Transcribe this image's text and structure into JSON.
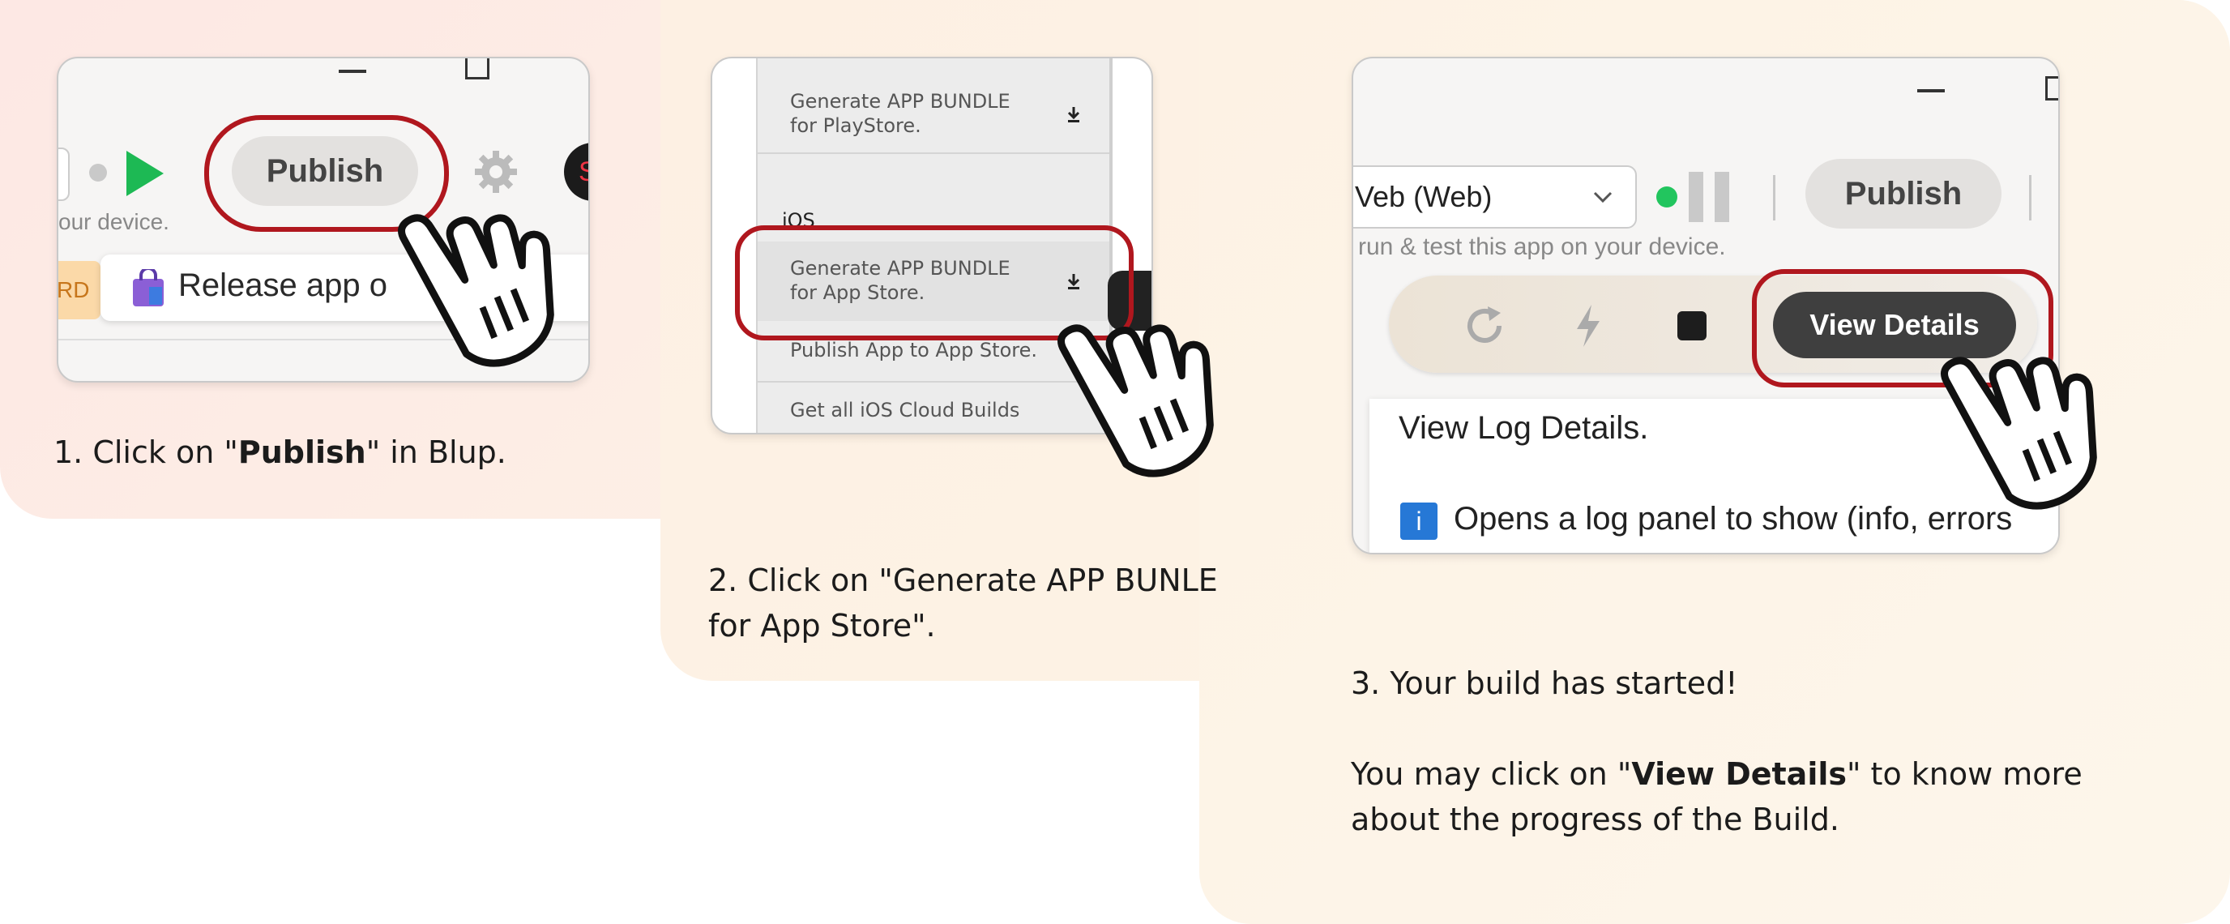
{
  "step1": {
    "publish_label": "Publish",
    "device_hint": "our device.",
    "badge_text": "RD",
    "release_text": "Release app o",
    "avatar_initial": "S",
    "caption_prefix": "1. Click on \"",
    "caption_bold": "Publish",
    "caption_suffix": "\" in Blup."
  },
  "step2": {
    "menu": {
      "playstore_line1": "Generate APP BUNDLE",
      "playstore_line2": "for PlayStore.",
      "section_ios": "iOS",
      "appstore_line1": "Generate APP BUNDLE",
      "appstore_line2": "for App Store.",
      "publish_appstore": "Publish App to App Store.",
      "cloud_builds": "Get all iOS Cloud Builds"
    },
    "caption_line1": "2. Click on \"Generate APP BUNLE",
    "caption_line2": "for App Store\"."
  },
  "step3": {
    "platform_select": "Veb (Web)",
    "publish_label": "Publish",
    "device_hint": "run & test this app on your device.",
    "view_details_label": "View Details",
    "tooltip_title": "View Log Details.",
    "tooltip_body": "Opens a log panel to show (info, errors",
    "caption_line1": "3. Your build has started!",
    "caption_prefix": "You may click on \"",
    "caption_bold": "View Details",
    "caption_suffix": "\" to know more",
    "caption_line3": "about the progress of the Build."
  },
  "colors": {
    "highlight_ring": "#b0171e",
    "play_green": "#1db954",
    "status_green": "#22c55e",
    "view_details_bg": "#3f3f3f"
  },
  "icons": [
    "play-icon",
    "gear-icon",
    "download-icon",
    "refresh-icon",
    "bolt-icon",
    "stop-icon",
    "pause-icon",
    "chevron-down-icon",
    "info-icon",
    "pointing-hand-icon",
    "shopping-bag-icon",
    "minimize-icon",
    "maximize-icon"
  ]
}
